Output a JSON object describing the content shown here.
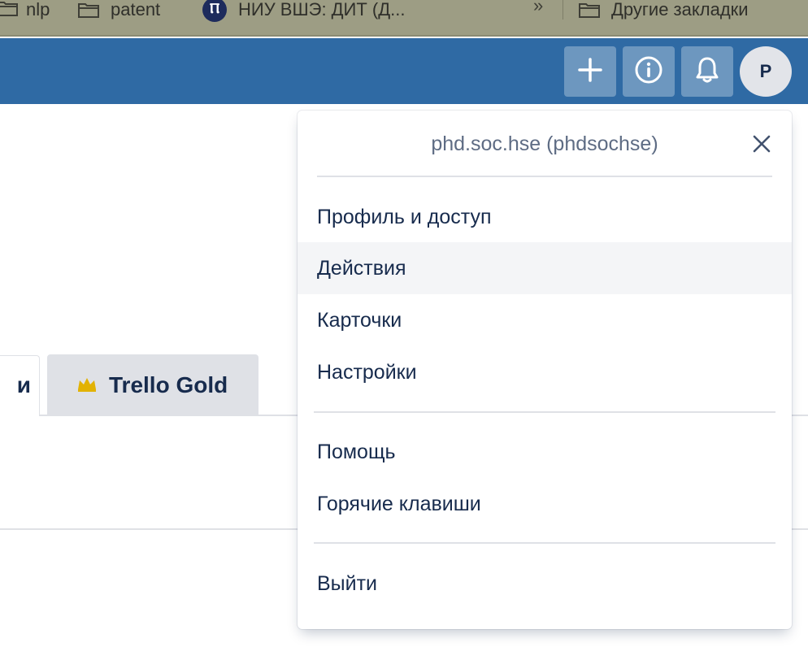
{
  "bookmarks": {
    "items": [
      {
        "label": "nlp",
        "icon": "folder-icon"
      },
      {
        "label": "patent",
        "icon": "folder-icon"
      },
      {
        "label": "НИУ ВШЭ: ДИТ (Д...",
        "icon": "hse-logo-icon"
      }
    ],
    "overflow": "»",
    "other": {
      "label": "Другие закладки",
      "icon": "folder-icon"
    }
  },
  "header": {
    "add_icon": "plus-icon",
    "info_icon": "info-icon",
    "notifications_icon": "bell-icon",
    "avatar_initial": "P",
    "color": "#2f6aa4"
  },
  "tabs": {
    "left_tab_fragment": "и",
    "gold_tab_label": "Trello Gold",
    "gold_icon": "crown-icon",
    "gold_color": "#e2b203"
  },
  "menu": {
    "title": "phd.soc.hse (phdsochse)",
    "close_icon": "close-icon",
    "items": [
      {
        "label": "Профиль и доступ"
      },
      {
        "label": "Действия"
      },
      {
        "label": "Карточки"
      },
      {
        "label": "Настройки"
      },
      {
        "label": "Помощь"
      },
      {
        "label": "Горячие клавиши"
      },
      {
        "label": "Выйти"
      }
    ],
    "hovered_item": "Действия"
  }
}
